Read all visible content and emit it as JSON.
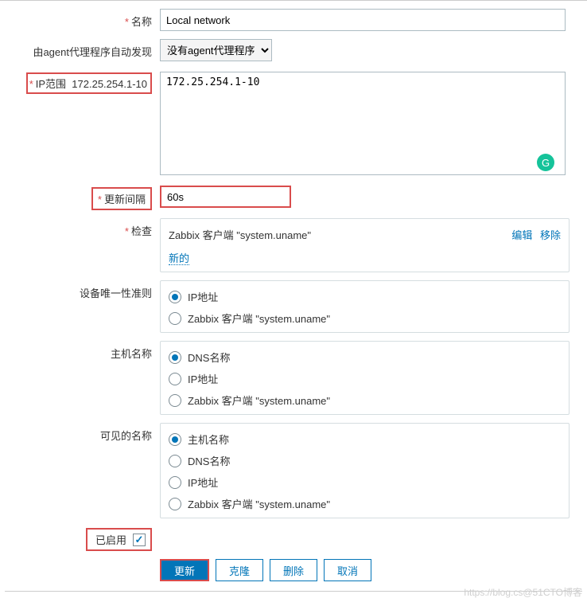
{
  "form": {
    "name": {
      "label": "名称",
      "value": "Local network"
    },
    "proxy": {
      "label": "由agent代理程序自动发现",
      "selected": "没有agent代理程序"
    },
    "iprange": {
      "label": "IP范围",
      "value": "172.25.254.1-10"
    },
    "interval": {
      "label": "更新间隔",
      "value": "60s"
    },
    "checks": {
      "label": "检查",
      "item": "Zabbix 客户端 \"system.uname\"",
      "edit": "编辑",
      "remove": "移除",
      "new": "新的"
    },
    "uniqueness": {
      "label": "设备唯一性准则",
      "options": [
        "IP地址",
        "Zabbix 客户端 \"system.uname\""
      ],
      "selected": 0
    },
    "hostname": {
      "label": "主机名称",
      "options": [
        "DNS名称",
        "IP地址",
        "Zabbix 客户端 \"system.uname\""
      ],
      "selected": 0
    },
    "visiblename": {
      "label": "可见的名称",
      "options": [
        "主机名称",
        "DNS名称",
        "IP地址",
        "Zabbix 客户端 \"system.uname\""
      ],
      "selected": 0
    },
    "enabled": {
      "label": "已启用",
      "checked": true
    },
    "buttons": {
      "update": "更新",
      "clone": "克隆",
      "delete": "删除",
      "cancel": "取消"
    }
  },
  "watermark": "https://blog.cs@51CTO博客"
}
